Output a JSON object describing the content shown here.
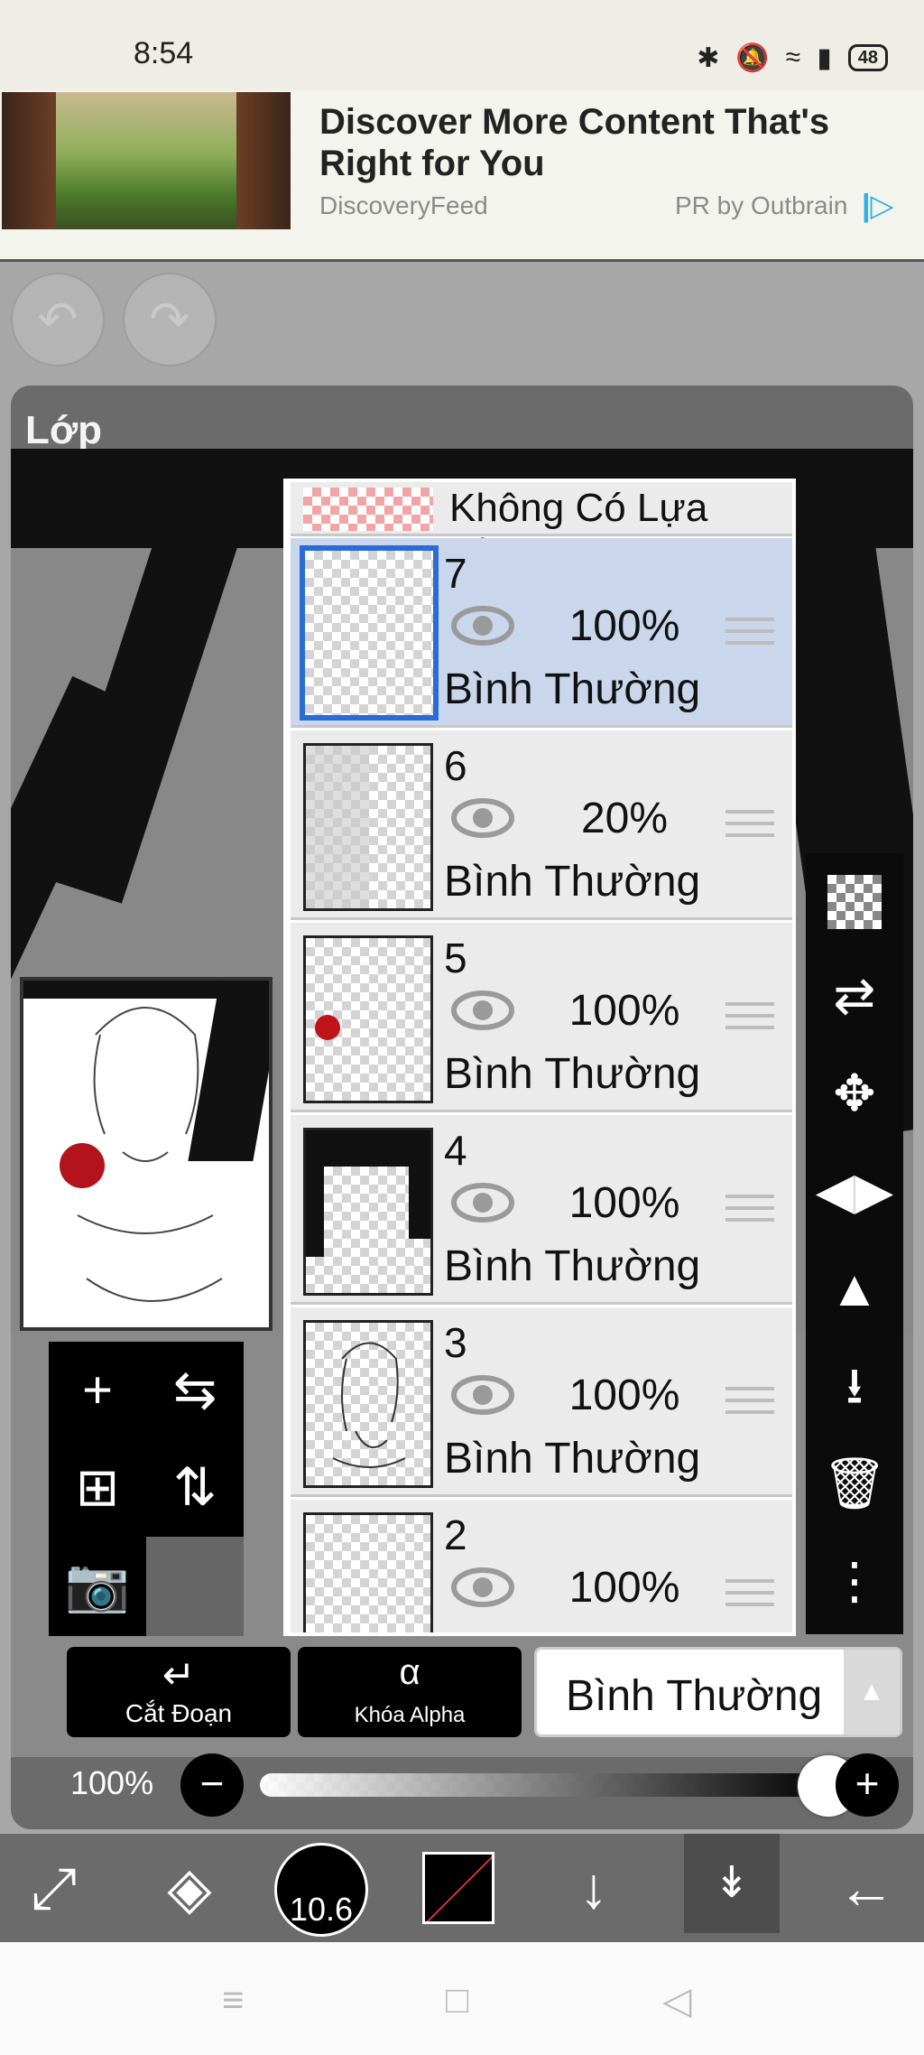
{
  "status_bar": {
    "time": "8:54",
    "icons": [
      "bluetooth-icon",
      "mute-icon",
      "wifi-icon",
      "signal-icon"
    ],
    "battery": "48"
  },
  "ad": {
    "title": "Discover More Content That's Right for You",
    "source": "DiscoveryFeed",
    "attribution": "PR by Outbrain"
  },
  "panel": {
    "title": "Lớp"
  },
  "layers": {
    "no_selection_label": "Không Có Lựa Chọn",
    "items": [
      {
        "number": "7",
        "opacity": "100%",
        "blend": "Bình Thường",
        "selected": true
      },
      {
        "number": "6",
        "opacity": "20%",
        "blend": "Bình Thường",
        "selected": false
      },
      {
        "number": "5",
        "opacity": "100%",
        "blend": "Bình Thường",
        "selected": false
      },
      {
        "number": "4",
        "opacity": "100%",
        "blend": "Bình Thường",
        "selected": false
      },
      {
        "number": "3",
        "opacity": "100%",
        "blend": "Bình Thường",
        "selected": false
      },
      {
        "number": "2",
        "opacity": "100%",
        "blend": "",
        "selected": false
      }
    ]
  },
  "right_toolbar": [
    "transparency-icon",
    "swap-layer-icon",
    "move-icon",
    "flip-horizontal-icon",
    "flip-vertical-icon",
    "merge-down-icon",
    "trash-icon",
    "more-icon"
  ],
  "left_toolbar": [
    "add-layer-icon",
    "flip-layer-horizontal-icon",
    "add-copy-layer-icon",
    "flip-layer-vertical-icon",
    "camera-icon"
  ],
  "bottom_controls": {
    "clip_label": "Cắt Đoạn",
    "alpha_lock_label": "Khóa Alpha",
    "blend_mode": "Bình Thường",
    "opacity_label": "100%",
    "opacity_value": 1.0
  },
  "tool_bar": {
    "brush_size": "10.6",
    "tools": [
      "select-transform-icon",
      "eraser-icon",
      "brush-size-icon",
      "color-swatch-icon",
      "arrow-down-icon",
      "layers-toggle-icon",
      "back-arrow-icon"
    ]
  },
  "nav_bar": [
    "menu-icon",
    "home-icon",
    "back-icon"
  ]
}
